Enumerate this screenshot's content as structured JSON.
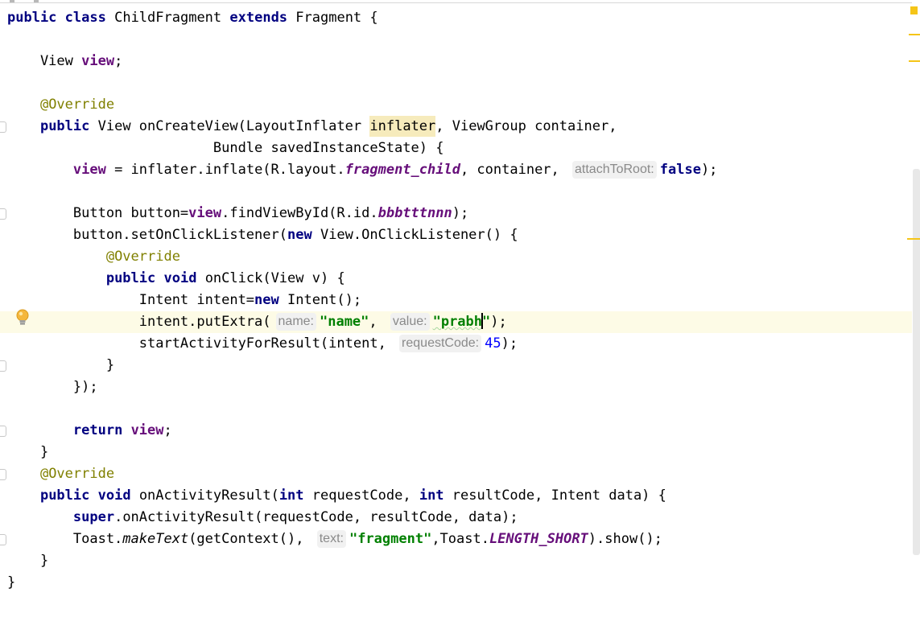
{
  "editor": {
    "file_name": "ChildFragment",
    "caret_line": 15,
    "lines": [
      [
        {
          "t": "public",
          "s": "kw"
        },
        {
          "t": " "
        },
        {
          "t": "class",
          "s": "kw"
        },
        {
          "t": " ChildFragment "
        },
        {
          "t": "extends",
          "s": "kw"
        },
        {
          "t": " Fragment {"
        }
      ],
      [],
      [
        {
          "t": "    View "
        },
        {
          "t": "view",
          "s": "field"
        },
        {
          "t": ";"
        }
      ],
      [],
      [
        {
          "t": "    "
        },
        {
          "t": "@Override",
          "s": "ann"
        }
      ],
      [
        {
          "t": "    "
        },
        {
          "t": "public",
          "s": "kw"
        },
        {
          "t": " View onCreateView(LayoutInflater "
        },
        {
          "t": "inflater",
          "s": "hl"
        },
        {
          "t": ", ViewGroup container,"
        }
      ],
      [
        {
          "t": "                         Bundle savedInstanceState) {"
        }
      ],
      [
        {
          "t": "        "
        },
        {
          "t": "view",
          "s": "field"
        },
        {
          "t": " = inflater.inflate(R.layout."
        },
        {
          "t": "fragment_child",
          "s": "sfield"
        },
        {
          "t": ", container, "
        },
        {
          "t": "attachToRoot:",
          "s": "hint"
        },
        {
          "t": "false",
          "s": "kw"
        },
        {
          "t": ");"
        }
      ],
      [],
      [
        {
          "t": "        Button button="
        },
        {
          "t": "view",
          "s": "field"
        },
        {
          "t": ".findViewById(R.id."
        },
        {
          "t": "bbbtttnnn",
          "s": "sfield"
        },
        {
          "t": ");"
        }
      ],
      [
        {
          "t": "        button.setOnClickListener("
        },
        {
          "t": "new",
          "s": "kw"
        },
        {
          "t": " View.OnClickListener() {"
        }
      ],
      [
        {
          "t": "            "
        },
        {
          "t": "@Override",
          "s": "ann"
        }
      ],
      [
        {
          "t": "            "
        },
        {
          "t": "public",
          "s": "kw"
        },
        {
          "t": " "
        },
        {
          "t": "void",
          "s": "kw"
        },
        {
          "t": " onClick(View v) {"
        }
      ],
      [
        {
          "t": "                Intent intent="
        },
        {
          "t": "new",
          "s": "kw"
        },
        {
          "t": " Intent();"
        }
      ],
      [
        {
          "t": "                intent.putExtra("
        },
        {
          "t": "name:",
          "s": "hint"
        },
        {
          "t": "\"name\"",
          "s": "str"
        },
        {
          "t": ", "
        },
        {
          "t": "value:",
          "s": "hint"
        },
        {
          "t": "\"prabh",
          "s": "str squiggle"
        },
        {
          "t": "",
          "s": "caret"
        },
        {
          "t": "\"",
          "s": "str"
        },
        {
          "t": ");"
        }
      ],
      [
        {
          "t": "                startActivityForResult(intent, "
        },
        {
          "t": "requestCode:",
          "s": "hint"
        },
        {
          "t": "45",
          "s": "num"
        },
        {
          "t": ");"
        }
      ],
      [
        {
          "t": "            }"
        }
      ],
      [
        {
          "t": "        });"
        }
      ],
      [],
      [
        {
          "t": "        "
        },
        {
          "t": "return",
          "s": "kw"
        },
        {
          "t": " "
        },
        {
          "t": "view",
          "s": "field"
        },
        {
          "t": ";"
        }
      ],
      [
        {
          "t": "    }"
        }
      ],
      [
        {
          "t": "    "
        },
        {
          "t": "@Override",
          "s": "ann"
        }
      ],
      [
        {
          "t": "    "
        },
        {
          "t": "public",
          "s": "kw"
        },
        {
          "t": " "
        },
        {
          "t": "void",
          "s": "kw"
        },
        {
          "t": " onActivityResult("
        },
        {
          "t": "int",
          "s": "kw"
        },
        {
          "t": " requestCode, "
        },
        {
          "t": "int",
          "s": "kw"
        },
        {
          "t": " resultCode, Intent data) {"
        }
      ],
      [
        {
          "t": "        "
        },
        {
          "t": "super",
          "s": "kw"
        },
        {
          "t": ".onActivityResult(requestCode, resultCode, data);"
        }
      ],
      [
        {
          "t": "        Toast."
        },
        {
          "t": "makeText",
          "s": "smethod"
        },
        {
          "t": "(getContext(), "
        },
        {
          "t": "text:",
          "s": "hint"
        },
        {
          "t": "\"fragment\"",
          "s": "str"
        },
        {
          "t": ",Toast."
        },
        {
          "t": "LENGTH_SHORT",
          "s": "sfield"
        },
        {
          "t": ").show();"
        }
      ],
      [
        {
          "t": "    }"
        }
      ],
      [
        {
          "t": "}"
        }
      ]
    ]
  },
  "gutter": {
    "intention_icon": "lightbulb-icon",
    "fold_marker_lines": [
      6,
      10,
      17,
      20,
      22,
      25
    ]
  },
  "colors": {
    "keyword": "#000080",
    "field": "#660e7a",
    "annotation": "#808000",
    "string": "#008000",
    "number": "#0000ff",
    "current_line": "#fdfbe6",
    "usage_highlight": "#f6ebbc",
    "warning_stripe": "#f5c518"
  }
}
